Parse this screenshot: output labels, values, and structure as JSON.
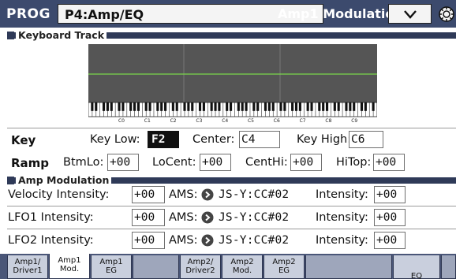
{
  "header": {
    "mode": "PROG",
    "page": "P4:Amp/EQ",
    "subpage": "Amp1 Modulation",
    "menu_icon": "chevron-down-icon",
    "settings_icon": "gear-icon"
  },
  "keyboard_track": {
    "section_title": "Keyboard Track",
    "octave_labels": [
      "C0",
      "C1",
      "C2",
      "C3",
      "C4",
      "C5",
      "C6",
      "C7",
      "C8",
      "C9"
    ],
    "key": {
      "row_label": "Key",
      "key_low_label": "Key Low:",
      "key_low_value": "F2",
      "center_label": "Center:",
      "center_value": "C4",
      "key_high_label": "Key High:",
      "key_high_value": "C6"
    },
    "ramp": {
      "row_label": "Ramp",
      "btmlo_label": "BtmLo:",
      "btmlo_value": "+00",
      "locent_label": "LoCent:",
      "locent_value": "+00",
      "centhi_label": "CentHi:",
      "centhi_value": "+00",
      "hitop_label": "HiTop:",
      "hitop_value": "+00"
    }
  },
  "amp_modulation": {
    "section_title": "Amp Modulation",
    "rows": [
      {
        "label": "Velocity Intensity:",
        "value": "+00",
        "ams_label": "AMS:",
        "source": "JS-Y:CC#02",
        "intensity_label": "Intensity:",
        "intensity_value": "+00"
      },
      {
        "label": "LFO1 Intensity:",
        "value": "+00",
        "ams_label": "AMS:",
        "source": "JS-Y:CC#02",
        "intensity_label": "Intensity:",
        "intensity_value": "+00"
      },
      {
        "label": "LFO2 Intensity:",
        "value": "+00",
        "ams_label": "AMS:",
        "source": "JS-Y:CC#02",
        "intensity_label": "Intensity:",
        "intensity_value": "+00"
      }
    ]
  },
  "tabs": [
    {
      "l1": "Amp1/",
      "l2": "Driver1",
      "active": false
    },
    {
      "l1": "Amp1",
      "l2": "Mod.",
      "active": true
    },
    {
      "l1": "Amp1",
      "l2": "EG",
      "active": false
    },
    {
      "l1": "",
      "l2": "",
      "active": false
    },
    {
      "l1": "Amp2/",
      "l2": "Driver2",
      "active": false
    },
    {
      "l1": "Amp2",
      "l2": "Mod.",
      "active": false
    },
    {
      "l1": "Amp2",
      "l2": "EG",
      "active": false
    },
    {
      "l1": "",
      "l2": "",
      "active": false
    },
    {
      "l1": "",
      "l2": "EQ",
      "active": false
    },
    {
      "l1": "",
      "l2": "",
      "active": false
    }
  ],
  "colors": {
    "header_bg": "#3c4a6d",
    "section_bar": "#2f3a58",
    "graph_bg": "#555555",
    "graph_line": "#7bd64a",
    "tab_bg": "#c9cfdd"
  }
}
